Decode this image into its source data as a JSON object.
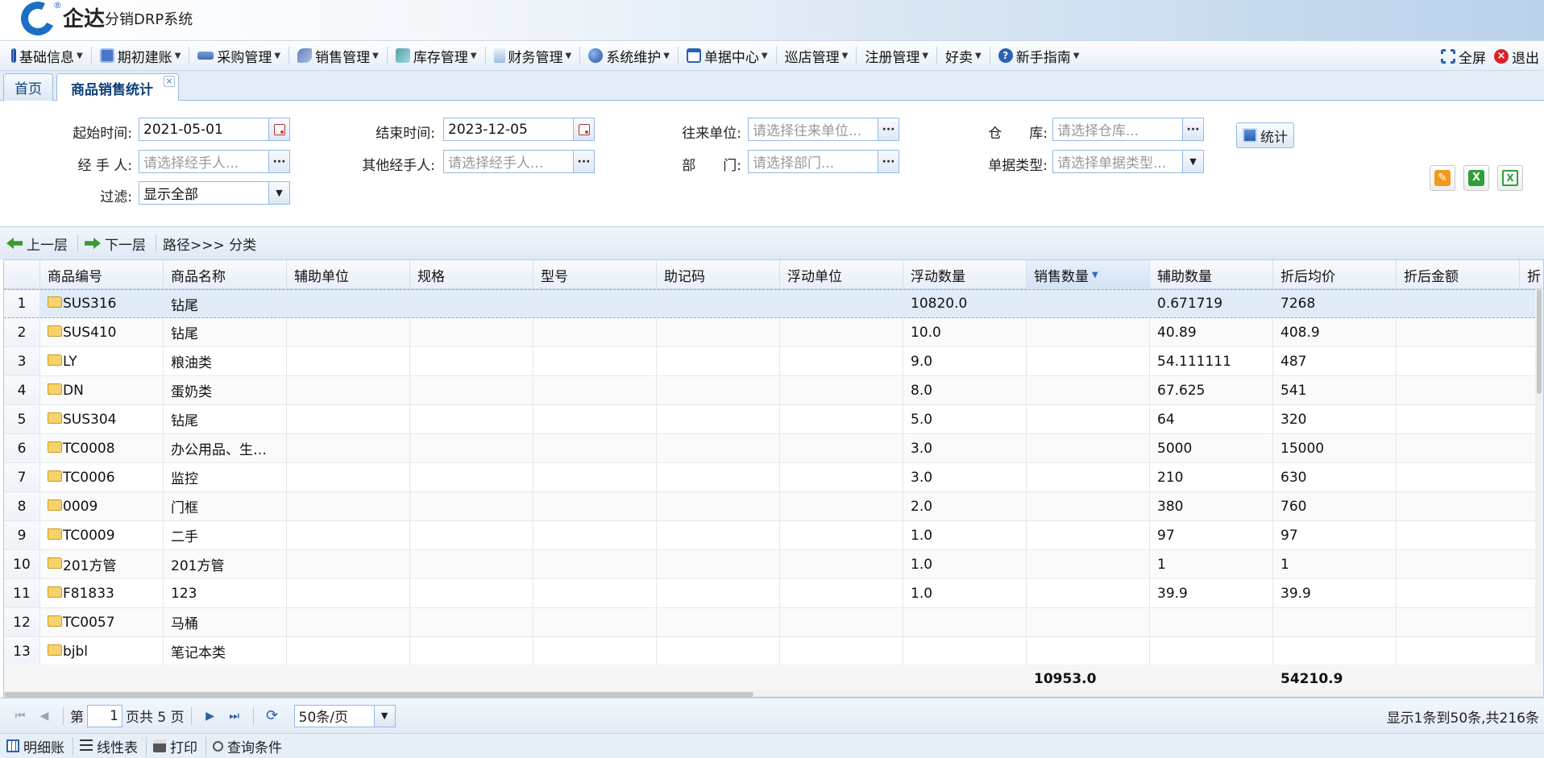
{
  "app": {
    "logo_text": "企达",
    "logo_sub": "分销DRP系统",
    "logo_reg": "®"
  },
  "menu": {
    "items": [
      {
        "label": "基础信息",
        "icon": "book-icon"
      },
      {
        "label": "期初建账",
        "icon": "ledger-icon"
      },
      {
        "label": "采购管理",
        "icon": "truck-icon"
      },
      {
        "label": "销售管理",
        "icon": "shoe-icon"
      },
      {
        "label": "库存管理",
        "icon": "box-icon"
      },
      {
        "label": "财务管理",
        "icon": "money-icon"
      },
      {
        "label": "系统维护",
        "icon": "globe-icon"
      },
      {
        "label": "单据中心",
        "icon": "document-icon"
      },
      {
        "label": "巡店管理",
        "icon": ""
      },
      {
        "label": "注册管理",
        "icon": ""
      },
      {
        "label": "好卖",
        "icon": ""
      },
      {
        "label": "新手指南",
        "icon": "help-icon"
      }
    ],
    "fullscreen": "全屏",
    "logout": "退出"
  },
  "tabs": {
    "home": "首页",
    "active": "商品销售统计",
    "close": "×"
  },
  "filters": {
    "start_label": "起始时间:",
    "start_value": "2021-05-01",
    "end_label": "结束时间:",
    "end_value": "2023-12-05",
    "partner_label": "往来单位:",
    "partner_placeholder": "请选择往来单位...",
    "warehouse_label": "仓　　库:",
    "warehouse_placeholder": "请选择仓库...",
    "handler_label": "经 手 人:",
    "handler_placeholder": "请选择经手人...",
    "other_handler_label": "其他经手人:",
    "other_handler_placeholder": "请选择经手人...",
    "dept_label": "部　　门:",
    "dept_placeholder": "请选择部门...",
    "doc_type_label": "单据类型:",
    "doc_type_placeholder": "请选择单据类型...",
    "filter_label": "过滤:",
    "filter_value": "显示全部",
    "stat_button": "统计",
    "dots": "···"
  },
  "nav": {
    "up": "上一层",
    "down": "下一层",
    "path": "路径>>> 分类"
  },
  "grid": {
    "columns": [
      "商品编号",
      "商品名称",
      "辅助单位",
      "规格",
      "型号",
      "助记码",
      "浮动单位",
      "浮动数量",
      "销售数量",
      "辅助数量",
      "折后均价",
      "折后金额",
      "折"
    ],
    "rows": [
      {
        "n": "1",
        "code": "SUS316",
        "name": "钻尾",
        "qty": "10820.0",
        "avg": "0.671719",
        "amt": "7268"
      },
      {
        "n": "2",
        "code": "SUS410",
        "name": "钻尾",
        "qty": "10.0",
        "avg": "40.89",
        "amt": "408.9"
      },
      {
        "n": "3",
        "code": "LY",
        "name": "粮油类",
        "qty": "9.0",
        "avg": "54.111111",
        "amt": "487"
      },
      {
        "n": "4",
        "code": "DN",
        "name": "蛋奶类",
        "qty": "8.0",
        "avg": "67.625",
        "amt": "541"
      },
      {
        "n": "5",
        "code": "SUS304",
        "name": "钻尾",
        "qty": "5.0",
        "avg": "64",
        "amt": "320"
      },
      {
        "n": "6",
        "code": "TC0008",
        "name": "办公用品、生…",
        "qty": "3.0",
        "avg": "5000",
        "amt": "15000"
      },
      {
        "n": "7",
        "code": "TC0006",
        "name": "监控",
        "qty": "3.0",
        "avg": "210",
        "amt": "630"
      },
      {
        "n": "8",
        "code": "0009",
        "name": "门框",
        "qty": "2.0",
        "avg": "380",
        "amt": "760"
      },
      {
        "n": "9",
        "code": "TC0009",
        "name": "二手",
        "qty": "1.0",
        "avg": "97",
        "amt": "97"
      },
      {
        "n": "10",
        "code": "201方管",
        "name": "201方管",
        "qty": "1.0",
        "avg": "1",
        "amt": "1"
      },
      {
        "n": "11",
        "code": "F81833",
        "name": "123",
        "qty": "1.0",
        "avg": "39.9",
        "amt": "39.9"
      },
      {
        "n": "12",
        "code": "TC0057",
        "name": "马桶",
        "qty": "",
        "avg": "",
        "amt": ""
      },
      {
        "n": "13",
        "code": "bjbl",
        "name": "笔记本类",
        "qty": "",
        "avg": "",
        "amt": ""
      }
    ],
    "total_qty": "10953.0",
    "total_amt": "54210.9"
  },
  "pager": {
    "page_prefix": "第",
    "page_value": "1",
    "page_suffix": "页共 5 页",
    "page_size": "50条/页",
    "info": "显示1条到50条,共216条"
  },
  "bottom": {
    "detail": "明细账",
    "line": "线性表",
    "print": "打印",
    "query": "查询条件"
  },
  "colors": {
    "accent": "#1a6fc4",
    "border": "#95b8e7",
    "tab_text": "#0e3f7a"
  }
}
